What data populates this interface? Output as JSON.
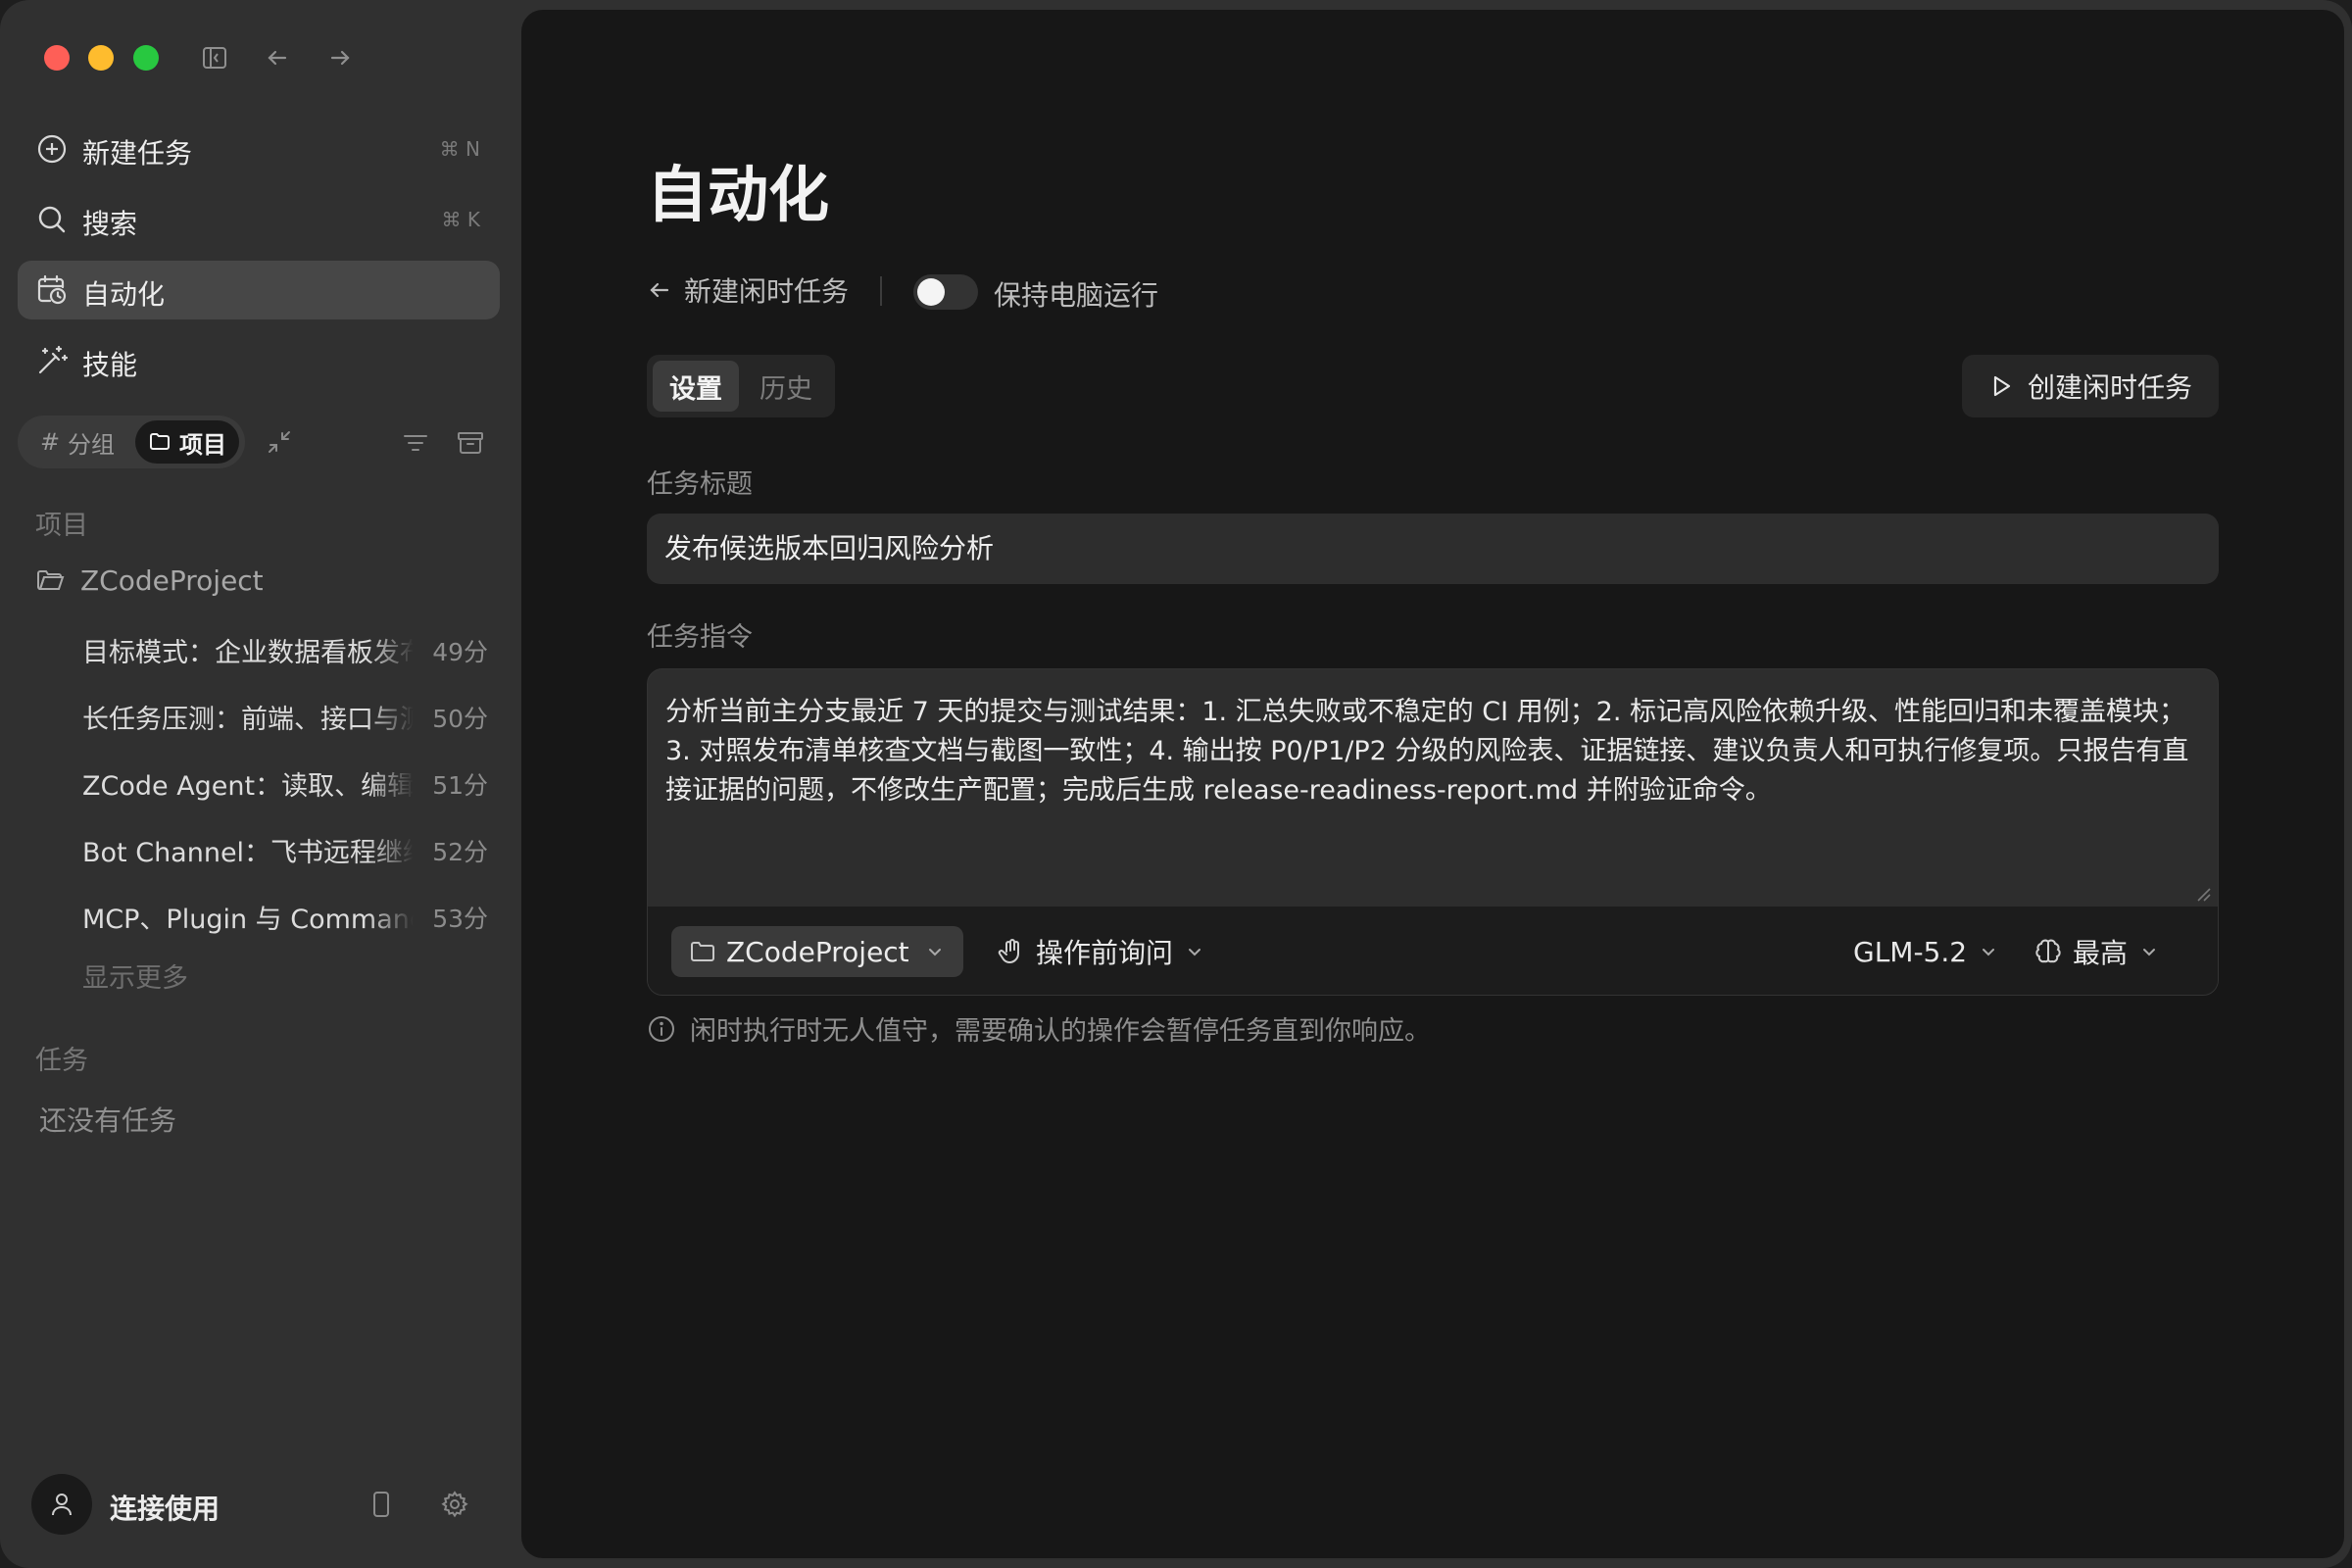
{
  "sidebar": {
    "nav": [
      {
        "label": "新建任务",
        "shortcut": "⌘ N"
      },
      {
        "label": "搜索",
        "shortcut": "⌘ K"
      },
      {
        "label": "自动化",
        "shortcut": ""
      },
      {
        "label": "技能",
        "shortcut": ""
      }
    ],
    "segment": {
      "group": "分组",
      "project": "项目"
    },
    "projects_heading": "项目",
    "folder": "ZCodeProject",
    "project_items": [
      {
        "title": "目标模式：企业数据看板发布",
        "age": "49分"
      },
      {
        "title": "长任务压测：前端、接口与测试",
        "age": "50分"
      },
      {
        "title": "ZCode Agent：读取、编辑与运行",
        "age": "51分"
      },
      {
        "title": "Bot Channel：飞书远程继续会话",
        "age": "52分"
      },
      {
        "title": "MCP、Plugin 与 Command 集成",
        "age": "53分"
      }
    ],
    "show_more": "显示更多",
    "tasks_heading": "任务",
    "tasks_empty": "还没有任务",
    "user_label": "连接使用"
  },
  "main": {
    "title": "自动化",
    "back_label": "新建闲时任务",
    "keep_awake_label": "保持电脑运行",
    "keep_awake_on": false,
    "tabs": [
      "设置",
      "历史"
    ],
    "create_button": "创建闲时任务",
    "task_title_label": "任务标题",
    "task_title_value": "发布候选版本回归风险分析",
    "instruction_label": "任务指令",
    "instruction_value": "分析当前主分支最近 7 天的提交与测试结果：1. 汇总失败或不稳定的 CI 用例；2. 标记高风险依赖升级、性能回归和未覆盖模块；3. 对照发布清单核查文档与截图一致性；4. 输出按 P0/P1/P2 分级的风险表、证据链接、建议负责人和可执行修复项。只报告有直接证据的问题，不修改生产配置；完成后生成 release-readiness-report.md 并附验证命令。",
    "project_select": "ZCodeProject",
    "permission_select": "操作前询问",
    "model_select": "GLM-5.2",
    "effort_select": "最高",
    "note": "闲时执行时无人值守，需要确认的操作会暂停任务直到你响应。"
  }
}
